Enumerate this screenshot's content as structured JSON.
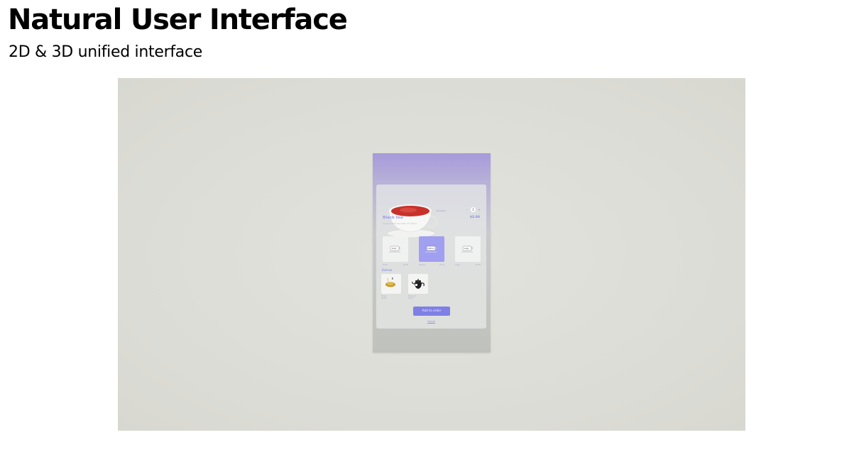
{
  "header": {
    "title": "Natural User Interface",
    "subtitle": "2D & 3D unified interface"
  },
  "order_panel": {
    "quantity_label": "Quantity",
    "quantity_decrement": "–",
    "quantity_value": "1",
    "quantity_increment": "+",
    "item_name": "Black tea",
    "item_price": "$3.00",
    "item_description": "Classic black tea with rich flavor",
    "sizes": [
      {
        "label": "Small",
        "price": "$0.00",
        "cup_text": "Small",
        "selected": false
      },
      {
        "label": "Medium",
        "price": "$0.00",
        "cup_text": "Medium",
        "selected": true
      },
      {
        "label": "Large",
        "price": "$0.50",
        "cup_text": "Large",
        "selected": false
      }
    ],
    "extras_heading": "Extras",
    "extras": [
      {
        "label": "Honey",
        "price": "$0.50",
        "icon": "honey-icon"
      },
      {
        "label": "Extra pot",
        "price": "$1.00",
        "icon": "teapot-icon"
      }
    ],
    "add_button_label": "Add to order",
    "cancel_label": "Cancel"
  },
  "colors": {
    "accent": "#7f7fe6",
    "selected_tile": "#a19ff0",
    "panel_top": "#a79ada",
    "scene_background": "#dcdcd6"
  }
}
